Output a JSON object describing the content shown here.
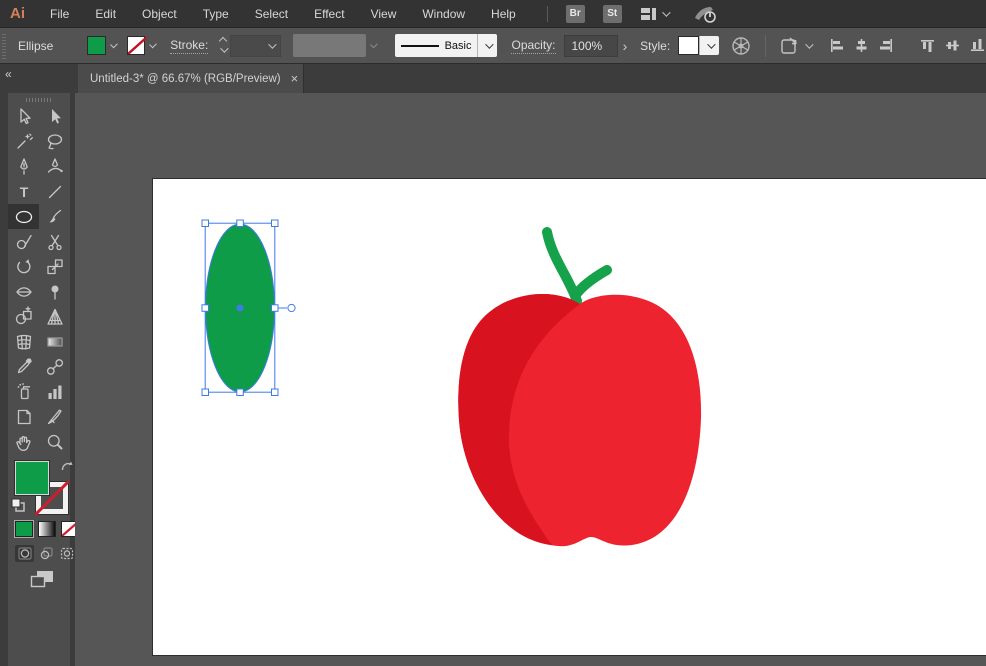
{
  "menu_bar": {
    "logo": "Ai",
    "items": [
      "File",
      "Edit",
      "Object",
      "Type",
      "Select",
      "Effect",
      "View",
      "Window",
      "Help"
    ],
    "bridge_label": "Br",
    "stock_label": "St",
    "right_icons": [
      "workspace-switcher-icon",
      "touch-workspace-icon"
    ]
  },
  "control_bar": {
    "tool_name": "Ellipse",
    "fill_swatch_color": "#0E9C49",
    "stroke_swatch": "none",
    "stroke_label": "Stroke:",
    "stroke_style_value": "Basic",
    "opacity_label": "Opacity:",
    "opacity_value": "100%",
    "opacity_more": "›",
    "style_label": "Style:",
    "icons": [
      "recolor-artwork-icon",
      "isolate-mode-icon"
    ],
    "align_icons": [
      "horizontal-align-left",
      "horizontal-align-center",
      "horizontal-align-right",
      "vertical-align-top",
      "vertical-align-center",
      "vertical-align-bottom"
    ]
  },
  "document_tab": {
    "title": "Untitled-3* @ 66.67% (RGB/Preview)",
    "close": "×",
    "collapse": "«"
  },
  "toolbar": {
    "tools": [
      "selection",
      "direct-selection",
      "magic-wand",
      "lasso",
      "pen",
      "curvature",
      "type",
      "line-segment",
      "ellipse",
      "paintbrush",
      "shaper",
      "scissors",
      "rotate",
      "scale",
      "width",
      "puppet-warp",
      "shape-builder",
      "perspective-grid",
      "mesh",
      "gradient",
      "eyedropper",
      "blend",
      "symbol-sprayer",
      "column-graph",
      "artboard",
      "slice",
      "hand",
      "zoom"
    ],
    "active_tool": "ellipse",
    "type_tool_glyph": "T",
    "fill_color": "#0E9C49",
    "stroke_color": "none"
  },
  "canvas": {
    "zoom": "66.67%",
    "artboard_color": "#ffffff",
    "selection_color": "#3E7BE8",
    "objects": {
      "ellipse": {
        "fill": "#0E9C49",
        "selected": true
      },
      "apple": {
        "body_color": "#ED2330",
        "shade_color": "#D9121F",
        "stem_color": "#16A24B"
      }
    }
  },
  "colors": {
    "menubar_bg": "#333333",
    "controlbar_bg": "#535353",
    "panel_bg": "#4d4d4d",
    "pasteboard_bg": "#565656",
    "logo_color": "#d1825d"
  }
}
